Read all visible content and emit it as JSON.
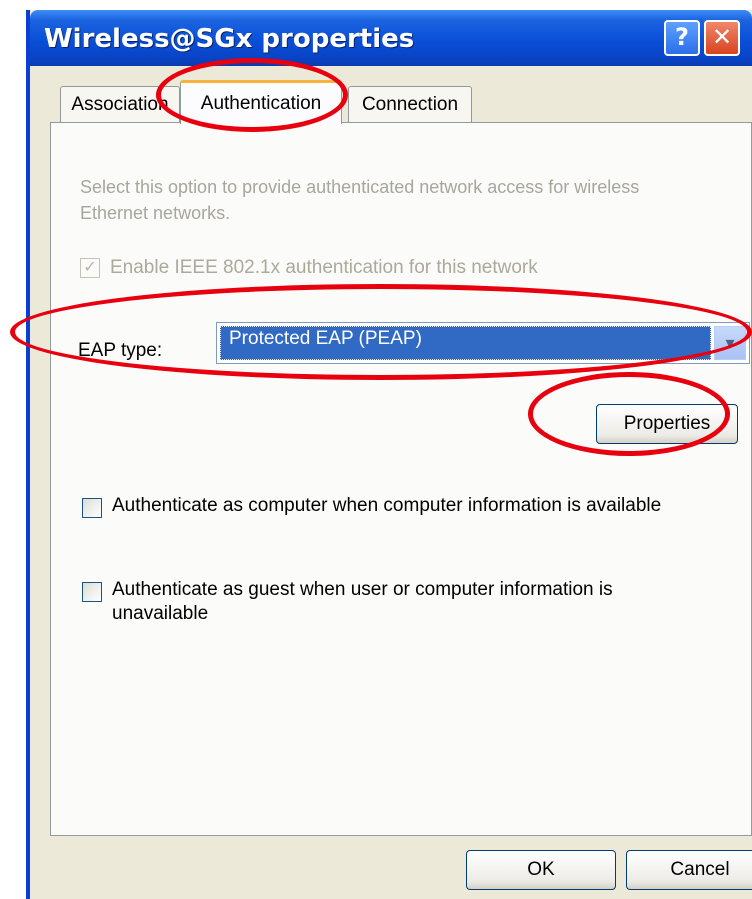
{
  "window": {
    "title": "Wireless@SGx properties",
    "help_glyph": "?",
    "close_glyph": "✕"
  },
  "tabs": [
    {
      "label": "Association"
    },
    {
      "label": "Authentication"
    },
    {
      "label": "Connection"
    }
  ],
  "authentication": {
    "description": "Select this option to provide authenticated network access for wireless Ethernet networks.",
    "enable_8021x": {
      "label": "Enable IEEE 802.1x authentication for this network",
      "checked": true,
      "disabled": true
    },
    "eap_type": {
      "label": "EAP type:",
      "value": "Protected EAP (PEAP)"
    },
    "properties_button": "Properties",
    "auth_as_computer": {
      "label": "Authenticate as computer when computer information is available",
      "checked": false
    },
    "auth_as_guest": {
      "label": "Authenticate as guest when user or computer information is unavailable",
      "checked": false
    }
  },
  "footer": {
    "ok_label": "OK",
    "cancel_label": "Cancel"
  },
  "colors": {
    "annotation_red": "#e8000f",
    "titlebar_blue": "#0a4fd8",
    "selection_blue": "#316ac5"
  }
}
